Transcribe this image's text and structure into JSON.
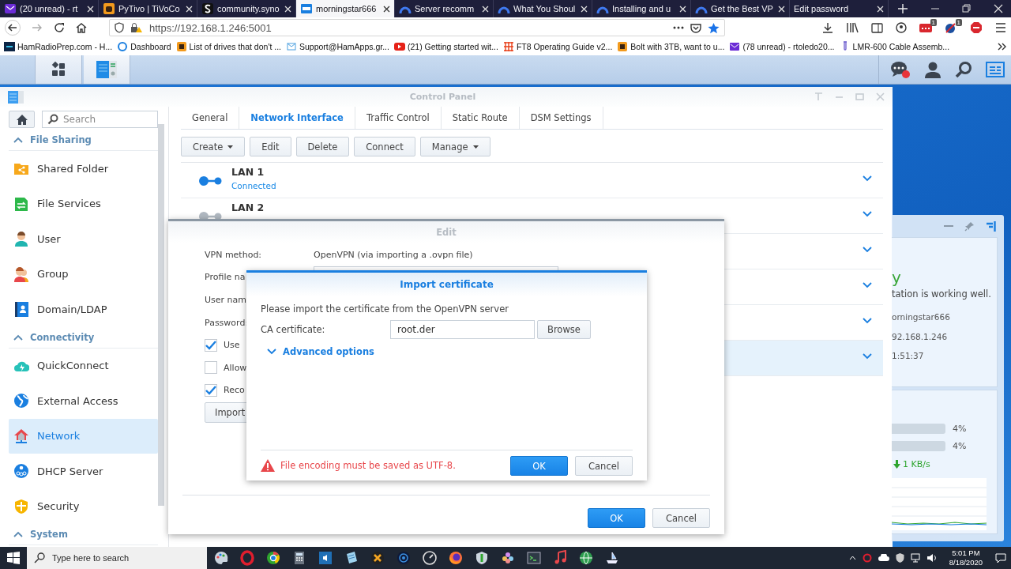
{
  "browser": {
    "tabs": [
      {
        "label": "(20 unread) - rt",
        "selected": false
      },
      {
        "label": "PyTivo | TiVoCo",
        "selected": false
      },
      {
        "label": "community.syno",
        "selected": false
      },
      {
        "label": "morningstar666",
        "selected": true
      },
      {
        "label": "Server recomm",
        "selected": false
      },
      {
        "label": "What You Shoul",
        "selected": false
      },
      {
        "label": "Installing and u",
        "selected": false
      },
      {
        "label": "Get the Best VP",
        "selected": false
      },
      {
        "label": "Edit password",
        "selected": false
      }
    ],
    "address": "https://192.168.1.246:5001",
    "extension_badges": [
      "1",
      "1"
    ],
    "bookmarks": [
      "HamRadioPrep.com - H...",
      "Dashboard",
      "List of drives that don't ...",
      "Support@HamApps.gr...",
      "(21) Getting started wit...",
      "FT8 Operating Guide v2...",
      "Bolt with 3TB, want to u...",
      "(78 unread) - rtoledo20...",
      "LMR-600 Cable Assemb..."
    ]
  },
  "control_panel": {
    "title": "Control Panel",
    "search": {
      "placeholder": "Search"
    },
    "sidebar": [
      {
        "section": "File Sharing",
        "expanded": true,
        "items": [
          {
            "label": "Shared Folder",
            "selected": false
          },
          {
            "label": "File Services",
            "selected": false
          },
          {
            "label": "User",
            "selected": false
          },
          {
            "label": "Group",
            "selected": false
          },
          {
            "label": "Domain/LDAP",
            "selected": false
          }
        ]
      },
      {
        "section": "Connectivity",
        "expanded": true,
        "items": [
          {
            "label": "QuickConnect",
            "selected": false
          },
          {
            "label": "External Access",
            "selected": false
          },
          {
            "label": "Network",
            "selected": true
          },
          {
            "label": "DHCP Server",
            "selected": false
          },
          {
            "label": "Security",
            "selected": false
          }
        ]
      },
      {
        "section": "System",
        "expanded": true
      }
    ],
    "tabs": [
      {
        "label": "General",
        "selected": false
      },
      {
        "label": "Network Interface",
        "selected": true
      },
      {
        "label": "Traffic Control",
        "selected": false
      },
      {
        "label": "Static Route",
        "selected": false
      },
      {
        "label": "DSM Settings",
        "selected": false
      }
    ],
    "toolbar": [
      {
        "label": "Create",
        "dropdown": true
      },
      {
        "label": "Edit",
        "dropdown": false
      },
      {
        "label": "Delete",
        "dropdown": false
      },
      {
        "label": "Connect",
        "dropdown": false
      },
      {
        "label": "Manage",
        "dropdown": true
      }
    ],
    "interfaces": [
      {
        "name": "LAN 1",
        "status": "Connected",
        "connected": true,
        "selected": false
      },
      {
        "name": "LAN 2",
        "connected": false,
        "selected": false
      },
      {
        "selected": false
      },
      {
        "selected": false
      },
      {
        "selected": false
      },
      {
        "selected": true
      }
    ]
  },
  "edit_dialog": {
    "title": "Edit",
    "rows": [
      {
        "kind": "text",
        "label": "VPN method:",
        "value": "OpenVPN (via importing a .ovpn file)"
      },
      {
        "kind": "field",
        "label": "Profile na"
      },
      {
        "kind": "label",
        "label": "User nam"
      },
      {
        "kind": "label",
        "label": "Password:"
      },
      {
        "kind": "checkbox",
        "label": "Use",
        "checked": true
      },
      {
        "kind": "checkbox",
        "label": "Allow",
        "checked": false
      },
      {
        "kind": "checkbox",
        "label": "Reco",
        "checked": true
      },
      {
        "kind": "button",
        "label": "Import"
      }
    ],
    "buttons": [
      {
        "label": "OK",
        "primary": true
      },
      {
        "label": "Cancel",
        "primary": false
      }
    ]
  },
  "import_dialog": {
    "title": "Import certificate",
    "instruction": "Please import the certificate from the OpenVPN server",
    "ca_label": "CA certificate:",
    "ca_value": "root.der",
    "browse": "Browse",
    "advanced": {
      "label": "Advanced options",
      "expanded": false
    },
    "warning": "File encoding must be saved as UTF-8.",
    "buttons": [
      {
        "label": "OK",
        "primary": true
      },
      {
        "label": "Cancel",
        "primary": false
      }
    ]
  },
  "widget": {
    "status_heading": "y",
    "status_text": "tation is working well.",
    "info": [
      "orningstar666",
      "92.168.1.246",
      "1:51:37"
    ],
    "readings": [
      "4%",
      "4%"
    ],
    "rate": "1 KB/s"
  },
  "windows_taskbar": {
    "search": {
      "placeholder": "Type here to search"
    },
    "time": "5:01 PM",
    "date": "8/18/2020"
  }
}
